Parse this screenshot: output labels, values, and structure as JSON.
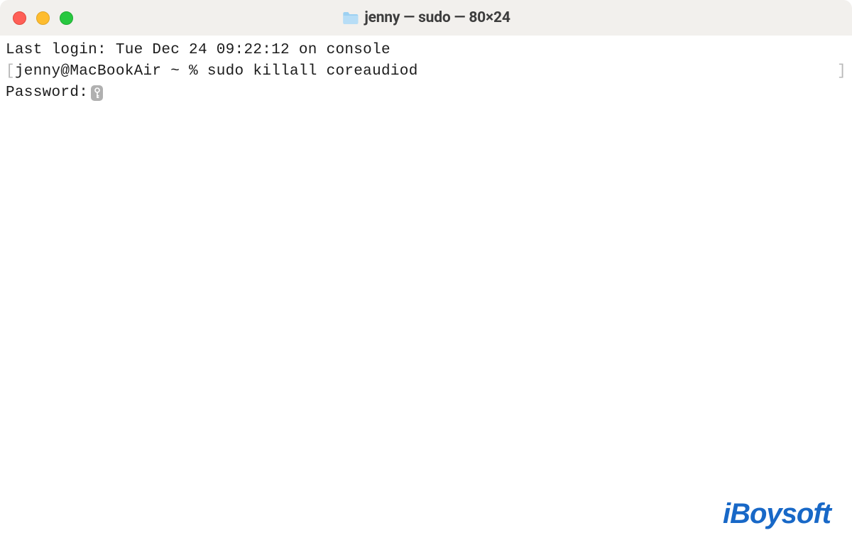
{
  "window": {
    "title": "jenny — sudo — 80×24"
  },
  "terminal": {
    "line1": "Last login: Tue Dec 24 09:22:12 on console",
    "line2_left_bracket": "[",
    "line2_content": "jenny@MacBookAir ~ % sudo killall coreaudiod",
    "line2_right_bracket": "]",
    "line3_label": "Password:"
  },
  "watermark": {
    "text": "iBoysoft"
  }
}
